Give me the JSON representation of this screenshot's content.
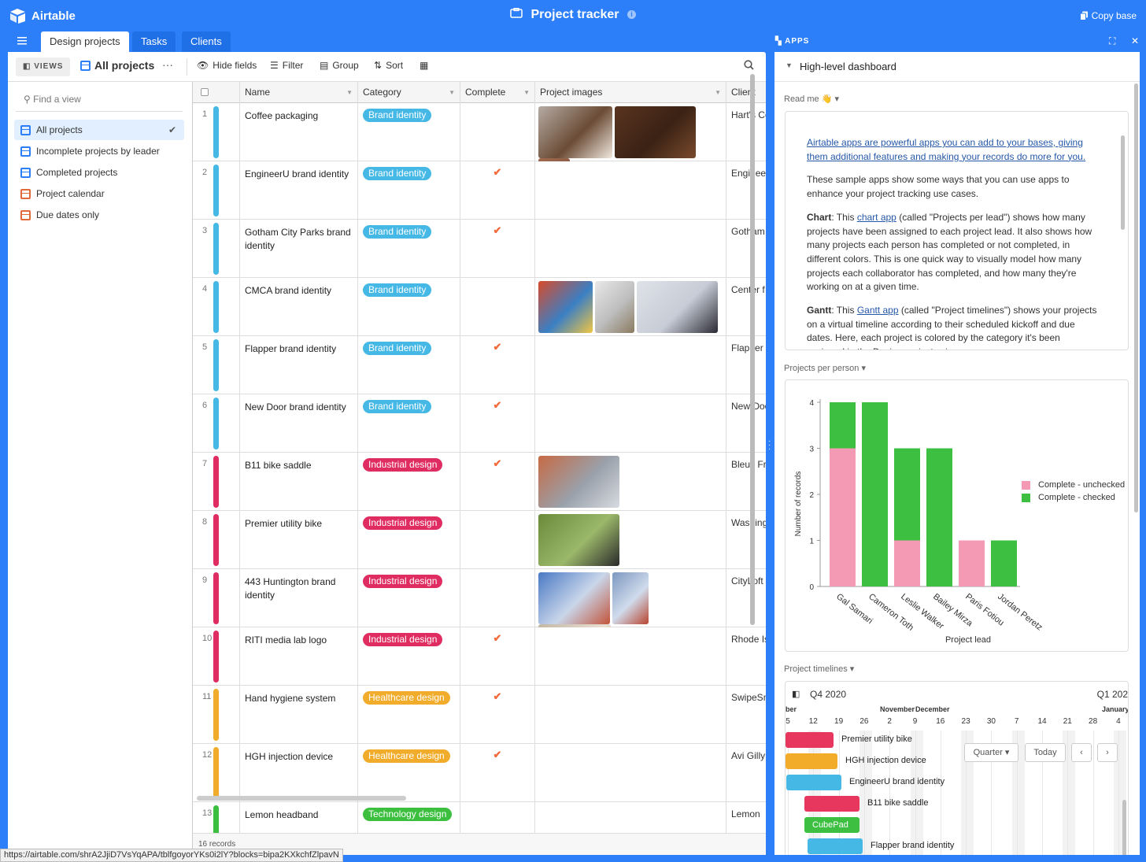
{
  "app": {
    "name": "Airtable",
    "base_title": "Project tracker",
    "copy_base": "Copy base"
  },
  "tabs": [
    "Design projects",
    "Tasks",
    "Clients"
  ],
  "viewbar": {
    "views": "VIEWS",
    "current_view": "All projects",
    "more": "···",
    "hide_fields": "Hide fields",
    "filter": "Filter",
    "group": "Group",
    "sort": "Sort"
  },
  "sidebar": {
    "find_placeholder": "Find a view",
    "views": [
      {
        "label": "All projects",
        "type": "grid",
        "active": true
      },
      {
        "label": "Incomplete projects by leader",
        "type": "grid"
      },
      {
        "label": "Completed projects",
        "type": "grid"
      },
      {
        "label": "Project calendar",
        "type": "calendar"
      },
      {
        "label": "Due dates only",
        "type": "calendar"
      }
    ]
  },
  "columns": [
    "Name",
    "Category",
    "Complete",
    "Project images",
    "Client"
  ],
  "rows": [
    {
      "n": "1",
      "name": "Coffee packaging",
      "category": "Brand identity",
      "complete": false,
      "images": 3,
      "client": "Hart's Co",
      "color": "#45b8e6"
    },
    {
      "n": "2",
      "name": "EngineerU brand identity",
      "category": "Brand identity",
      "complete": true,
      "images": 0,
      "client": "EngineerU",
      "color": "#45b8e6"
    },
    {
      "n": "3",
      "name": "Gotham City Parks brand identity",
      "category": "Brand identity",
      "complete": true,
      "images": 0,
      "client": "Gotham",
      "color": "#45b8e6"
    },
    {
      "n": "4",
      "name": "CMCA brand identity",
      "category": "Brand identity",
      "complete": false,
      "images": 3,
      "client": "Center f",
      "color": "#45b8e6"
    },
    {
      "n": "5",
      "name": "Flapper brand identity",
      "category": "Brand identity",
      "complete": true,
      "images": 0,
      "client": "Flapper",
      "color": "#45b8e6"
    },
    {
      "n": "6",
      "name": "New Door brand identity",
      "category": "Brand identity",
      "complete": true,
      "images": 0,
      "client": "New Doo",
      "color": "#45b8e6"
    },
    {
      "n": "7",
      "name": "B11 bike saddle",
      "category": "Industrial design",
      "complete": true,
      "images": 1,
      "client": "Bleux Fr",
      "color": "#e02d61"
    },
    {
      "n": "8",
      "name": "Premier utility bike",
      "category": "Industrial design",
      "complete": false,
      "images": 1,
      "client": "Washing",
      "color": "#e02d61"
    },
    {
      "n": "9",
      "name": "443 Huntington brand identity",
      "category": "Industrial design",
      "complete": false,
      "images": 3,
      "client": "CityLoft",
      "color": "#e02d61"
    },
    {
      "n": "10",
      "name": "RITI media lab logo",
      "category": "Industrial design",
      "complete": true,
      "images": 0,
      "client": "Rhode Is",
      "color": "#e02d61"
    },
    {
      "n": "11",
      "name": "Hand hygiene system",
      "category": "Healthcare design",
      "complete": true,
      "images": 0,
      "client": "SwipeSm",
      "color": "#f0ac2a"
    },
    {
      "n": "12",
      "name": "HGH injection device",
      "category": "Healthcare design",
      "complete": true,
      "images": 0,
      "client": "Avi Gilly",
      "color": "#f0ac2a"
    },
    {
      "n": "13",
      "name": "Lemon headband",
      "category": "Technology design",
      "complete": false,
      "images": 0,
      "client": "Lemon",
      "color": "#3cbf3f"
    }
  ],
  "records_count": "16 records",
  "status_url": "https://airtable.com/shrA2JjiD7VsYqAPA/tblfgoyorYKs0i2lY?blocks=bipa2KXkchfZlpavN",
  "apps": {
    "label": "APPS",
    "dashboard": "High-level dashboard",
    "readme_label": "Read me 👋",
    "readme": {
      "intro": "Airtable apps are powerful apps you can add to your bases, giving them additional features and making your records do more for you.",
      "p2": "These sample apps show some ways that you can use apps to enhance your project tracking use cases.",
      "chart_head": "Chart",
      "chart_pre": ": This ",
      "chart_link": "chart app",
      "chart_post": " (called \"Projects per lead\") shows how many projects have been assigned to each project lead. It also shows how many projects each person has completed or not completed, in different colors. This is one quick way to visually model how many projects each collaborator has completed, and how many they're working on at a given time.",
      "gantt_head": "Gantt",
      "gantt_pre": ": This ",
      "gantt_link": "Gantt app",
      "gantt_post": " (called \"Project timelines\") shows your projects on a virtual timeline according to their scheduled kickoff and due dates. Here, each project is colored by the category it's been assigned in the Design projects view."
    },
    "chart_label": "Projects per person",
    "timeline_label": "Project timelines"
  },
  "chart_data": {
    "type": "bar",
    "stacked": true,
    "categories": [
      "Gal Samari",
      "Cameron Toth",
      "Leslie Walker",
      "Bailey Mirza",
      "Paris Fotiou",
      "Jordan Peretz"
    ],
    "series": [
      {
        "name": "Complete - unchecked",
        "values": [
          3,
          0,
          1,
          0,
          1,
          0
        ],
        "color": "#f49ab4"
      },
      {
        "name": "Complete - checked",
        "values": [
          1,
          4,
          2,
          3,
          0,
          1
        ],
        "color": "#3dbf41"
      }
    ],
    "xlabel": "Project lead",
    "ylabel": "Number of records",
    "ylim": [
      0,
      4
    ],
    "yticks": [
      "0",
      "1",
      "2",
      "3",
      "4"
    ],
    "legend": "right"
  },
  "gantt": {
    "quarter": "Q4 2020",
    "next_quarter": "Q1 202",
    "months": [
      "ber",
      "November",
      "December",
      "January"
    ],
    "days": [
      "5",
      "12",
      "19",
      "26",
      "2",
      "9",
      "16",
      "23",
      "30",
      "7",
      "14",
      "21",
      "28",
      "4"
    ],
    "controls": {
      "scale": "Quarter",
      "today": "Today",
      "prev": "‹",
      "next": "›"
    },
    "bars": [
      {
        "label": "Premier utility bike",
        "color": "#e8375f"
      },
      {
        "label": "HGH injection device",
        "color": "#f2ac2a"
      },
      {
        "label": "EngineerU brand identity",
        "color": "#45b8e6"
      },
      {
        "label": "B11 bike saddle",
        "color": "#e8375f"
      },
      {
        "label": "CubePad",
        "color": "#3dbf41"
      },
      {
        "label": "Flapper brand identity",
        "color": "#45b8e6"
      }
    ]
  }
}
